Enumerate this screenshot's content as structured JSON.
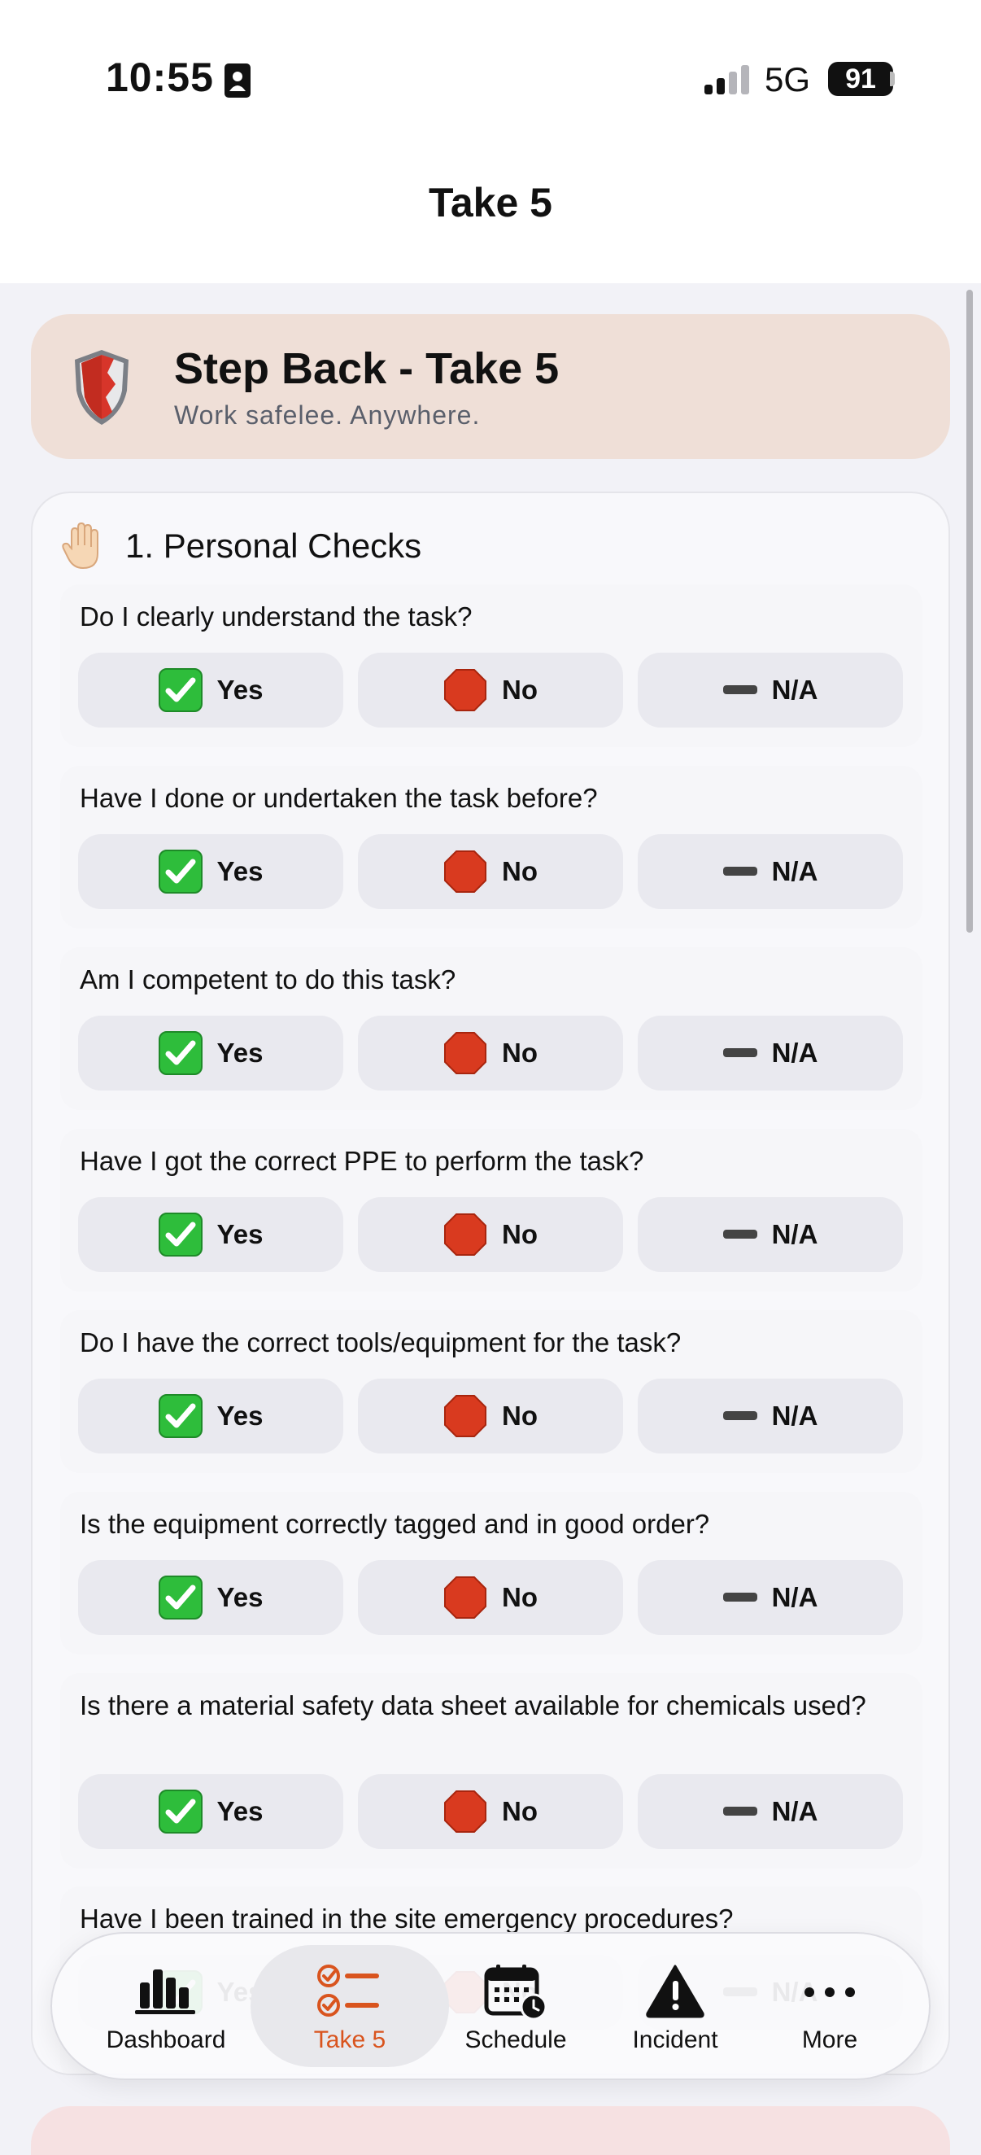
{
  "status_bar": {
    "time": "10:55",
    "network": "5G",
    "battery": "91"
  },
  "nav": {
    "title": "Take 5"
  },
  "header": {
    "title": "Step Back - Take 5",
    "subtitle": "Work safelee. Anywhere."
  },
  "section": {
    "title": "1. Personal Checks",
    "questions": [
      {
        "text": "Do I clearly understand the task?"
      },
      {
        "text": "Have I done or undertaken the task before?"
      },
      {
        "text": "Am I competent to do this task?"
      },
      {
        "text": "Have I got the correct PPE to perform the task?"
      },
      {
        "text": "Do I have the correct tools/equipment for the task?"
      },
      {
        "text": "Is the equipment correctly tagged and in good order?"
      },
      {
        "text": "Is there a material safety data sheet available for chemicals used?"
      },
      {
        "text": "Have I been trained in the site emergency procedures?"
      }
    ],
    "options": {
      "yes": "Yes",
      "no": "No",
      "na": "N/A"
    }
  },
  "tabs": [
    {
      "label": "Dashboard",
      "icon": "chart-bar-icon",
      "active": false
    },
    {
      "label": "Take 5",
      "icon": "checklist-icon",
      "active": true
    },
    {
      "label": "Schedule",
      "icon": "calendar-clock-icon",
      "active": false
    },
    {
      "label": "Incident",
      "icon": "warning-icon",
      "active": false
    },
    {
      "label": "More",
      "icon": "ellipsis-icon",
      "active": false
    }
  ],
  "colors": {
    "accent": "#d9541e",
    "header_bg": "#efdfd7",
    "yes_green": "#2ebd3b",
    "no_red": "#d93a1f"
  }
}
